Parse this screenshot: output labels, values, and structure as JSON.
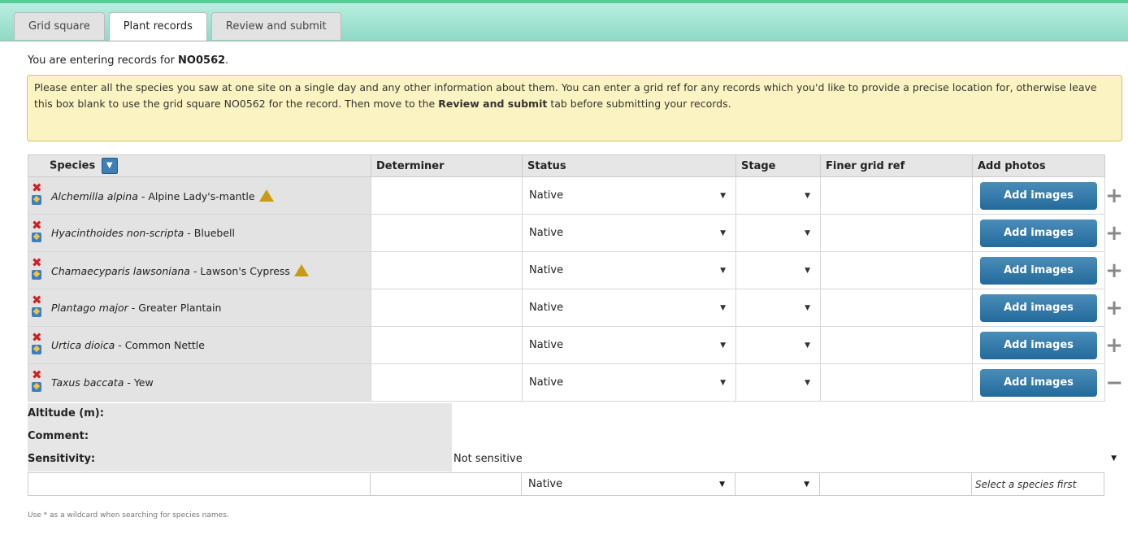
{
  "tabs": [
    {
      "label": "Grid square"
    },
    {
      "label": "Plant records"
    },
    {
      "label": "Review and submit"
    }
  ],
  "intro": {
    "prefix": "You are entering records for ",
    "grid_square": "NO0562",
    "suffix": "."
  },
  "notice": {
    "part1": "Please enter all the species you saw at one site on a single day and any other information about them. You can enter a grid ref for any records which you'd like to provide a precise location for, otherwise leave this box blank to use the grid square NO0562 for the record. Then move to the ",
    "bold": "Review and submit",
    "part2": " tab before submitting your records."
  },
  "columns": {
    "species": "Species",
    "determiner": "Determiner",
    "status": "Status",
    "stage": "Stage",
    "grid_ref": "Finer grid ref",
    "photos": "Add photos"
  },
  "rows": [
    {
      "latin": "Alchemilla alpina",
      "common": " - Alpine Lady's-mantle",
      "warning": true,
      "status": "Native",
      "button": "Add images",
      "toggle": "+"
    },
    {
      "latin": "Hyacinthoides non-scripta",
      "common": " - Bluebell",
      "warning": false,
      "status": "Native",
      "button": "Add images",
      "toggle": "+"
    },
    {
      "latin": "Chamaecyparis lawsoniana",
      "common": " - Lawson's Cypress",
      "warning": true,
      "status": "Native",
      "button": "Add images",
      "toggle": "+"
    },
    {
      "latin": "Plantago major",
      "common": " - Greater Plantain",
      "warning": false,
      "status": "Native",
      "button": "Add images",
      "toggle": "+"
    },
    {
      "latin": "Urtica dioica",
      "common": " - Common Nettle",
      "warning": false,
      "status": "Native",
      "button": "Add images",
      "toggle": "+"
    },
    {
      "latin": "Taxus baccata",
      "common": " - Yew",
      "warning": false,
      "status": "Native",
      "button": "Add images",
      "toggle": "−"
    }
  ],
  "extra": {
    "altitude_label": "Altitude (m):",
    "comment_label": "Comment:",
    "sensitivity_label": "Sensitivity:",
    "sensitivity_value": "Not sensitive"
  },
  "new_row": {
    "status": "Native",
    "photos_hint": "Select a species first"
  },
  "footer_hint": "Use * as a wildcard when searching for species names."
}
